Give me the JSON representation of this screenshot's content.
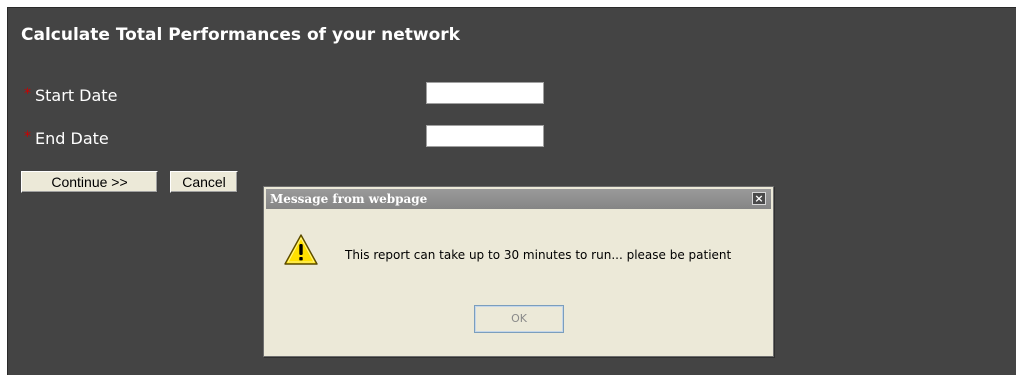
{
  "form": {
    "title": "Calculate Total Performances of your network",
    "required_marker": "*",
    "start_date": {
      "label": "Start Date",
      "value": ""
    },
    "end_date": {
      "label": "End Date",
      "value": ""
    },
    "continue_label": "Continue >>",
    "cancel_label": "Cancel"
  },
  "dialog": {
    "title": "Message from webpage",
    "close_glyph": "×",
    "message": "This report can take up to 30 minutes to run... please be patient",
    "ok_label": "OK",
    "icon": "warning-icon"
  },
  "colors": {
    "panel_bg": "#444444",
    "required": "#cc0000",
    "dialog_bg": "#ece9d8",
    "warning_fill": "#ffe000"
  }
}
